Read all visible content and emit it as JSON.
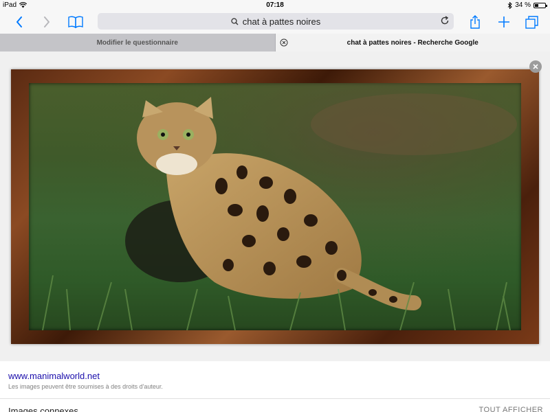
{
  "status_bar": {
    "device": "iPad",
    "time": "07:18",
    "battery_text": "34 %",
    "battery_level": 0.34,
    "icons": [
      "wifi-icon",
      "bluetooth-icon",
      "battery-icon"
    ]
  },
  "toolbar": {
    "address_text": "chat à pattes noires",
    "icons": [
      "back-icon",
      "forward-icon",
      "bookmarks-icon",
      "search-icon",
      "reload-icon",
      "share-icon",
      "add-icon",
      "tabs-icon"
    ]
  },
  "tabs": [
    {
      "label": "Modifier le questionnaire",
      "active": false
    },
    {
      "label": "chat à pattes noires - Recherche Google",
      "active": true
    }
  ],
  "image_viewer": {
    "icons": [
      "close-icon"
    ]
  },
  "info": {
    "source": "www.manimalworld.net",
    "copyright_note": "Les images peuvent être soumises à des droits d'auteur."
  },
  "related": {
    "title": "Images connexes",
    "show_all": "TOUT AFFICHER"
  },
  "colors": {
    "accent": "#007aff",
    "link": "#1a0dab",
    "toolbar_bg": "#f7f7f7",
    "address_bg": "#e3e3e8"
  }
}
